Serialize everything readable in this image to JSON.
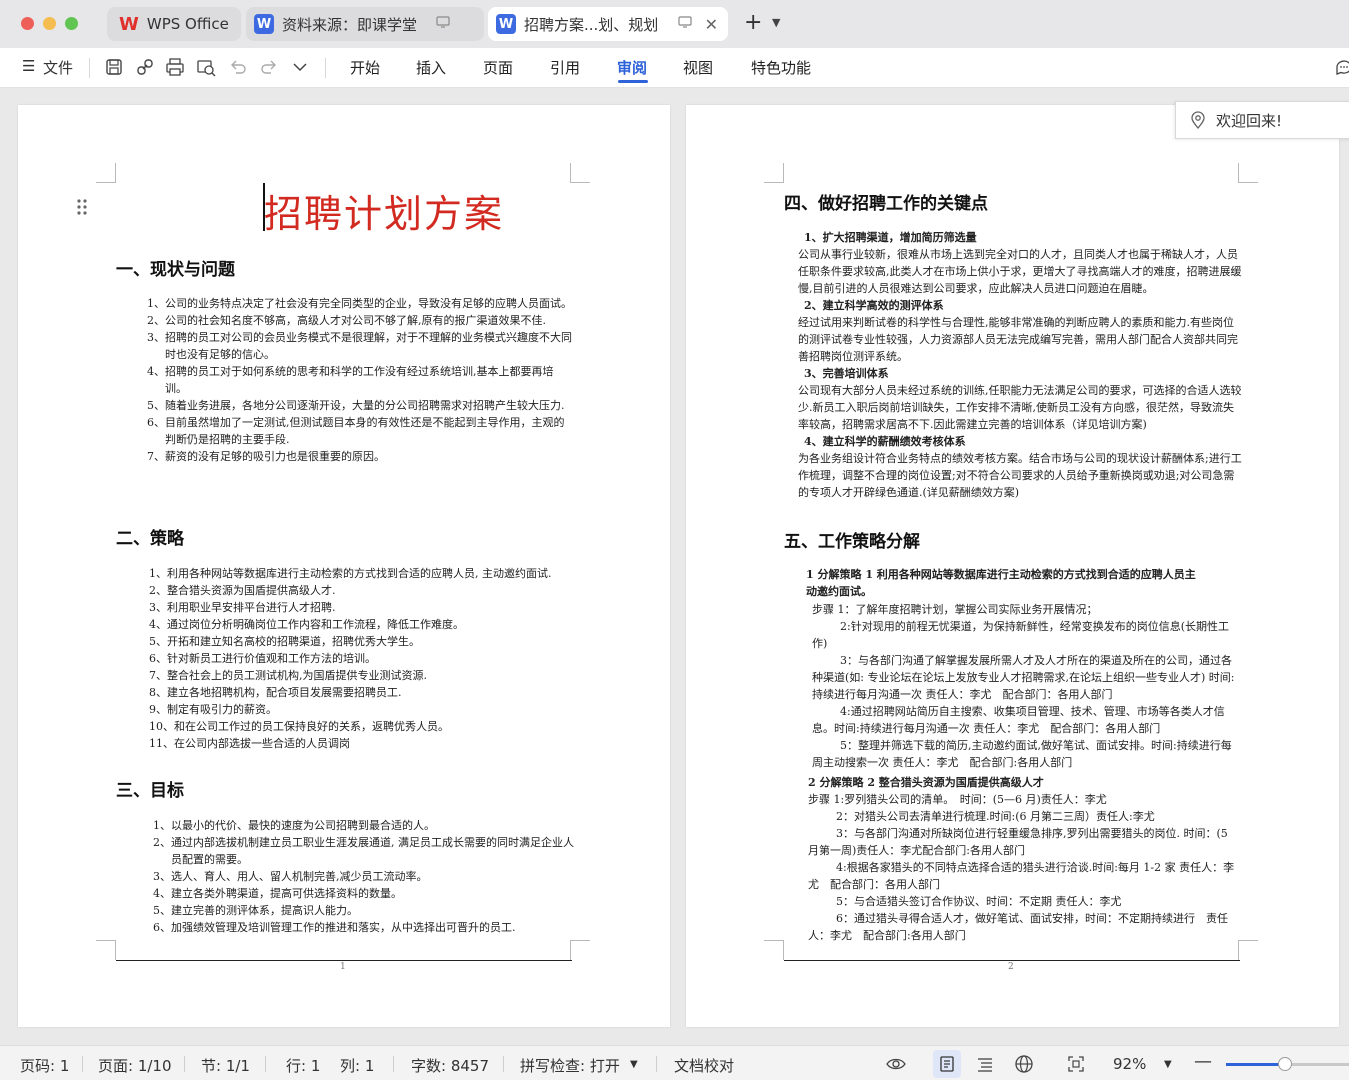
{
  "window": {
    "tabs": [
      {
        "label": "WPS Office"
      },
      {
        "label": "资料来源：即课学堂"
      },
      {
        "label": "招聘方案...划、规划"
      }
    ]
  },
  "toolbar": {
    "file_label": "文件",
    "menu": [
      "开始",
      "插入",
      "页面",
      "引用",
      "审阅",
      "视图",
      "特色功能"
    ],
    "active_menu": "审阅"
  },
  "popup": {
    "welcome": "欢迎回来!"
  },
  "page1": {
    "title": "招聘计划方案",
    "sections": [
      {
        "heading": "一、现状与问题",
        "items": [
          {
            "num": "1、",
            "text": "公司的业务特点决定了社会没有完全同类型的企业，导致没有足够的应聘人员面试。"
          },
          {
            "num": "2、",
            "text": "公司的社会知名度不够高，高级人才对公司不够了解,原有的报广渠道效果不佳."
          },
          {
            "num": "3、",
            "text": "招聘的员工对公司的会员业务模式不是很理解，对于不理解的业务模式兴趣度不大同时也没有足够的信心。"
          },
          {
            "num": "4、",
            "text": "招聘的员工对于如何系统的思考和科学的工作没有经过系统培训,基本上都要再培训。"
          },
          {
            "num": "5、",
            "text": "随着业务进展，各地分公司逐渐开设，大量的分公司招聘需求对招聘产生较大压力."
          },
          {
            "num": "6、",
            "text": "目前虽然增加了一定测试,但测试题目本身的有效性还是不能起到主导作用，主观的判断仍是招聘的主要手段."
          },
          {
            "num": "7、",
            "text": "薪资的没有足够的吸引力也是很重要的原因。"
          }
        ]
      },
      {
        "heading": "二、策略",
        "items": [
          {
            "num": "1、",
            "text": "利用各种网站等数据库进行主动检索的方式找到合适的应聘人员, 主动邀约面试."
          },
          {
            "num": "2、",
            "text": "整合猎头资源为国盾提供高级人才."
          },
          {
            "num": "3、",
            "text": "利用职业早安排平台进行人才招聘."
          },
          {
            "num": "4、",
            "text": "通过岗位分析明确岗位工作内容和工作流程，降低工作难度。"
          },
          {
            "num": "5、",
            "text": "开拓和建立知名高校的招聘渠道，招聘优秀大学生。"
          },
          {
            "num": "6、",
            "text": "针对新员工进行价值观和工作方法的培训。"
          },
          {
            "num": "7、",
            "text": "整合社会上的员工测试机构,为国盾提供专业测试资源."
          },
          {
            "num": "8、",
            "text": "建立各地招聘机构，配合项目发展需要招聘员工."
          },
          {
            "num": "9、",
            "text": "制定有吸引力的薪资。"
          },
          {
            "num": "10、",
            "text": "和在公司工作过的员工保持良好的关系，返聘优秀人员。"
          },
          {
            "num": "11、",
            "text": "在公司内部选拔一些合适的人员调岗"
          }
        ]
      },
      {
        "heading": "三、目标",
        "items": [
          {
            "num": "1、",
            "text": "以最小的代价、最快的速度为公司招聘到最合适的人。"
          },
          {
            "num": "2、",
            "text": "通过内部选拔机制建立员工职业生涯发展通道, 满足员工成长需要的同时满足企业人员配置的需要。"
          },
          {
            "num": "3、",
            "text": "选人、育人、用人、留人机制完善,减少员工流动率。"
          },
          {
            "num": "4、",
            "text": "建立各类外聘渠道，提高可供选择资料的数量。"
          },
          {
            "num": "5、",
            "text": "建立完善的测评体系，提高识人能力。"
          },
          {
            "num": "6、",
            "text": "加强绩效管理及培训管理工作的推进和落实，从中选择出可晋升的员工."
          }
        ]
      }
    ],
    "page_number": "1"
  },
  "page2": {
    "section4": {
      "heading": "四、做好招聘工作的关键点",
      "blocks": [
        {
          "title": "1、扩大招聘渠道，增加简历筛选量",
          "text": "公司从事行业较新，很难从市场上选到完全对口的人才，且同类人才也属于稀缺人才，人员任职条件要求较高,此类人才在市场上供小于求，更增大了寻找高端人才的难度，招聘进展缓慢,目前引进的人员很难达到公司要求，应此解决人员进口问题迫在眉睫。"
        },
        {
          "title": "2、建立科学高效的测评体系",
          "text": "经过试用来判断试卷的科学性与合理性,能够非常准确的判断应聘人的素质和能力.有些岗位的测评试卷专业性较强，人力资源部人员无法完成编写完善，需用人部门配合人资部共同完善招聘岗位测评系统。"
        },
        {
          "title": "3、完善培训体系",
          "text": "公司现有大部分人员未经过系统的训练,任职能力无法满足公司的要求，可选择的合适人选较少.新员工入职后岗前培训缺失，工作安排不清晰,使新员工没有方向感，很茫然，导致流失率较高，招聘需求居高不下.因此需建立完善的培训体系（详见培训方案)"
        },
        {
          "title": "4、建立科学的薪酬绩效考核体系",
          "text": "为各业务组设计符合业务特点的绩效考核方案。结合市场与公司的现状设计薪酬体系;进行工作梳理，调整不合理的岗位设置;对不符合公司要求的人员给予重新换岗或劝退;对公司急需的专项人才开辟绿色通道.(详见薪酬绩效方案)"
        }
      ]
    },
    "section5": {
      "heading": "五、工作策略分解",
      "strategy1_title": "1 分解策略 1 利用各种网站等数据库进行主动检索的方式找到合适的应聘人员主动邀约面试。",
      "strategy1_steps": [
        "步骤 1：了解年度招聘计划，掌握公司实际业务开展情况；",
        "2:针对现用的前程无忧渠道，为保持新鲜性，经常变换发布的岗位信息(长期性工作)",
        "3：与各部门沟通了解掌握发展所需人才及人才所在的渠道及所在的公司，通过各种渠道(如: 专业论坛在论坛上发放专业人才招聘需求,在论坛上组织一些专业人才) 时间:持续进行每月沟通一次 责任人：李尤　配合部门：各用人部门",
        "4:通过招聘网站简历自主搜索、收集项目管理、技术、管理、市场等各类人才信息。时间:持续进行每月沟通一次 责任人：李尤　配合部门：各用人部门",
        "5：整理并筛选下载的简历,主动邀约面试,做好笔试、面试安排。时间:持续进行每周主动搜索一次 责任人：李尤　配合部门:各用人部门"
      ],
      "strategy2_title": "2 分解策略 2 整合猎头资源为国盾提供高级人才",
      "strategy2_steps": [
        "步骤 1:罗列猎头公司的清单。　时间：(5—6 月)责任人：李尤",
        "2：对猎头公司去清单进行梳理.时间:(6 月第二三周）责任人:李尤",
        "3：与各部门沟通对所缺岗位进行轻重缓急排序,罗列出需要猎头的岗位. 时间：(5 月第一周)责任人：李尤配合部门:各用人部门",
        "4:根据各家猎头的不同特点选择合适的猎头进行洽谈.时间:每月 1-2 家 责任人：李尤　配合部门：各用人部门",
        "5：与合适猎头签订合作协议、时间：不定期 责任人：李尤",
        "6：通过猎头寻得合适人才，做好笔试、面试安排，时间：不定期持续进行　责任人：李尤　配合部门:各用人部门"
      ]
    },
    "page_number": "2"
  },
  "statusbar": {
    "page_count": "页码: 1",
    "pages": "页面: 1/10",
    "section": "节: 1/1",
    "row": "行: 1",
    "col": "列: 1",
    "word_count": "字数: 8457",
    "spellcheck": "拼写检查: 打开",
    "proofread": "文档校对",
    "zoom": "92%",
    "zoom_level": 0.46
  },
  "colors": {
    "accent": "#2e62d9",
    "title_red": "#d22a20",
    "wps_red": "#e0302c"
  }
}
